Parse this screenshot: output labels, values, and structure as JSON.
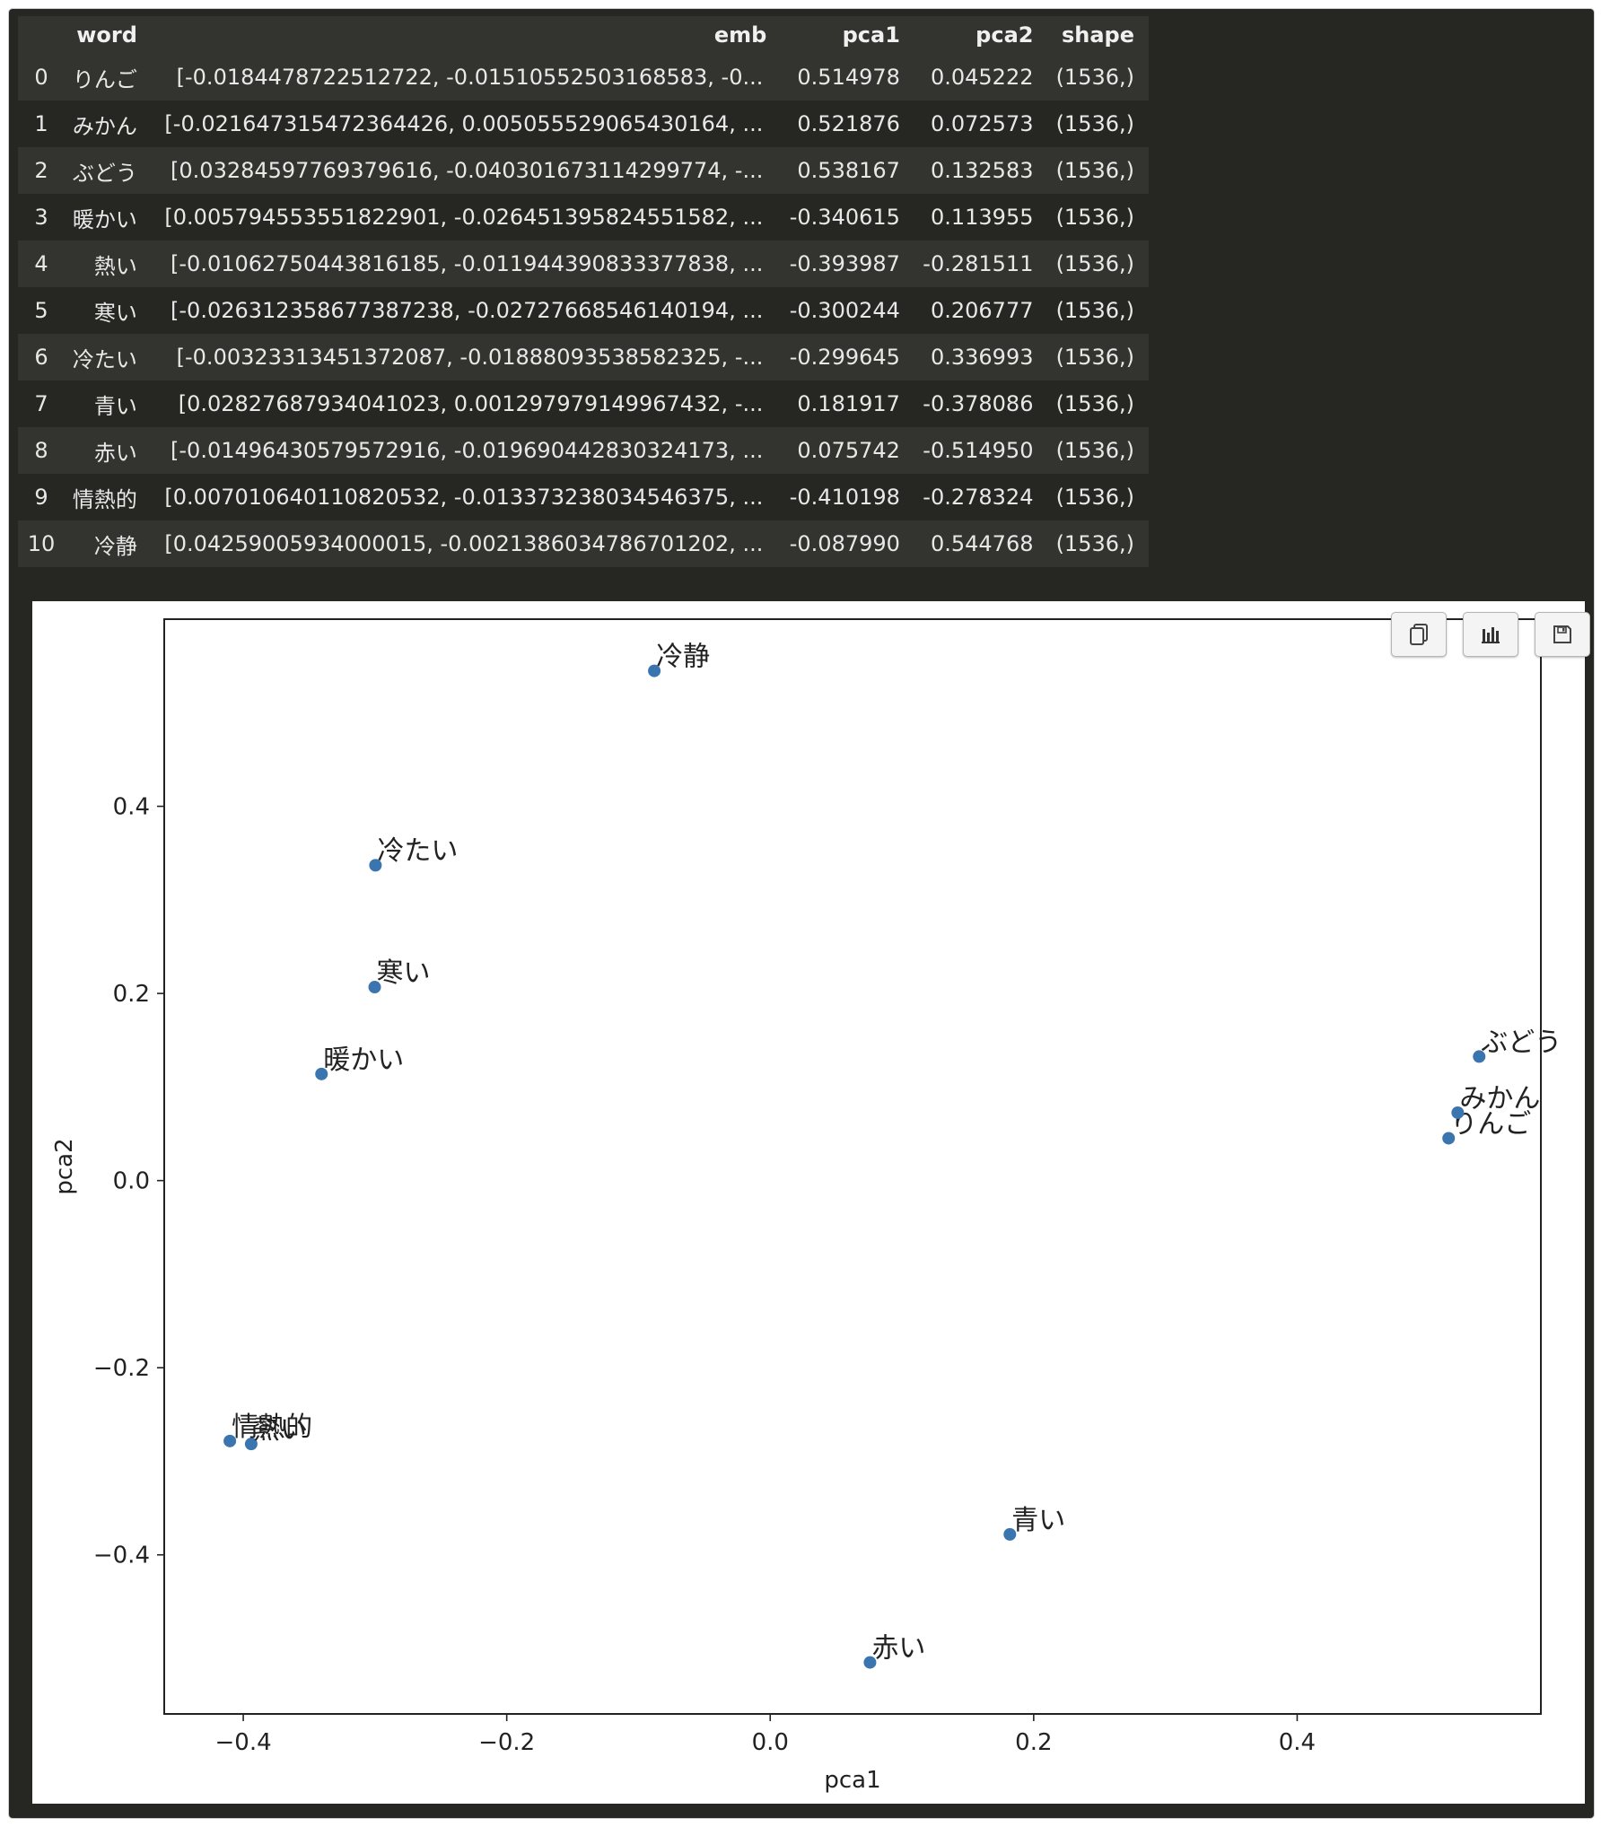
{
  "table": {
    "columns": [
      "",
      "word",
      "emb",
      "pca1",
      "pca2",
      "shape"
    ],
    "rows": [
      [
        "0",
        "りんご",
        "[-0.0184478722512722, -0.01510552503168583, -0...",
        "0.514978",
        "0.045222",
        "(1536,)"
      ],
      [
        "1",
        "みかん",
        "[-0.021647315472364426, 0.005055529065430164, ...",
        "0.521876",
        "0.072573",
        "(1536,)"
      ],
      [
        "2",
        "ぶどう",
        "[0.03284597769379616, -0.040301673114299774, -...",
        "0.538167",
        "0.132583",
        "(1536,)"
      ],
      [
        "3",
        "暖かい",
        "[0.005794553551822901, -0.026451395824551582, ...",
        "-0.340615",
        "0.113955",
        "(1536,)"
      ],
      [
        "4",
        "熱い",
        "[-0.01062750443816185, -0.011944390833377838, ...",
        "-0.393987",
        "-0.281511",
        "(1536,)"
      ],
      [
        "5",
        "寒い",
        "[-0.026312358677387238, -0.02727668546140194, ...",
        "-0.300244",
        "0.206777",
        "(1536,)"
      ],
      [
        "6",
        "冷たい",
        "[-0.00323313451372087, -0.01888093538582325, -...",
        "-0.299645",
        "0.336993",
        "(1536,)"
      ],
      [
        "7",
        "青い",
        "[0.02827687934041023, 0.00129797914996743​2, -...",
        "0.181917",
        "-0.378086",
        "(1536,)"
      ],
      [
        "8",
        "赤い",
        "[-0.01496430579572916, -0.019690442830324173, ...",
        "0.075742",
        "-0.514950",
        "(1536,)"
      ],
      [
        "9",
        "情熱的",
        "[0.007010640110820532, -0.013373238034546375, ...",
        "-0.410198",
        "-0.278324",
        "(1536,)"
      ],
      [
        "10",
        "冷静",
        "[0.04259005934000015, -0.0021386034786701202, ...",
        "-0.087990",
        "0.544768",
        "(1536,)"
      ]
    ]
  },
  "toolbar": {
    "buttons": [
      "copy-icon",
      "chart-icon",
      "save-icon"
    ]
  },
  "chart_data": {
    "type": "scatter",
    "xlabel": "pca1",
    "ylabel": "pca2",
    "xlim": [
      -0.46,
      0.585
    ],
    "ylim": [
      -0.57,
      0.6
    ],
    "xticks": [
      -0.4,
      -0.2,
      0.0,
      0.2,
      0.4
    ],
    "xtick_labels": [
      "−0.4",
      "−0.2",
      "0.0",
      "0.2",
      "0.4"
    ],
    "yticks": [
      -0.4,
      -0.2,
      0.0,
      0.2,
      0.4
    ],
    "ytick_labels": [
      "−0.4",
      "−0.2",
      "0.0",
      "0.2",
      "0.4"
    ],
    "grid": false,
    "point_color": "#3b75af",
    "points": [
      {
        "label": "りんご",
        "x": 0.514978,
        "y": 0.045222
      },
      {
        "label": "みかん",
        "x": 0.521876,
        "y": 0.072573
      },
      {
        "label": "ぶどう",
        "x": 0.538167,
        "y": 0.132583
      },
      {
        "label": "暖かい",
        "x": -0.340615,
        "y": 0.113955
      },
      {
        "label": "熱い",
        "x": -0.393987,
        "y": -0.281511
      },
      {
        "label": "寒い",
        "x": -0.300244,
        "y": 0.206777
      },
      {
        "label": "冷たい",
        "x": -0.299645,
        "y": 0.336993
      },
      {
        "label": "青い",
        "x": 0.181917,
        "y": -0.378086
      },
      {
        "label": "赤い",
        "x": 0.075742,
        "y": -0.51495
      },
      {
        "label": "情熱的",
        "x": -0.410198,
        "y": -0.278324
      },
      {
        "label": "冷静",
        "x": -0.08799,
        "y": 0.544768
      }
    ]
  }
}
